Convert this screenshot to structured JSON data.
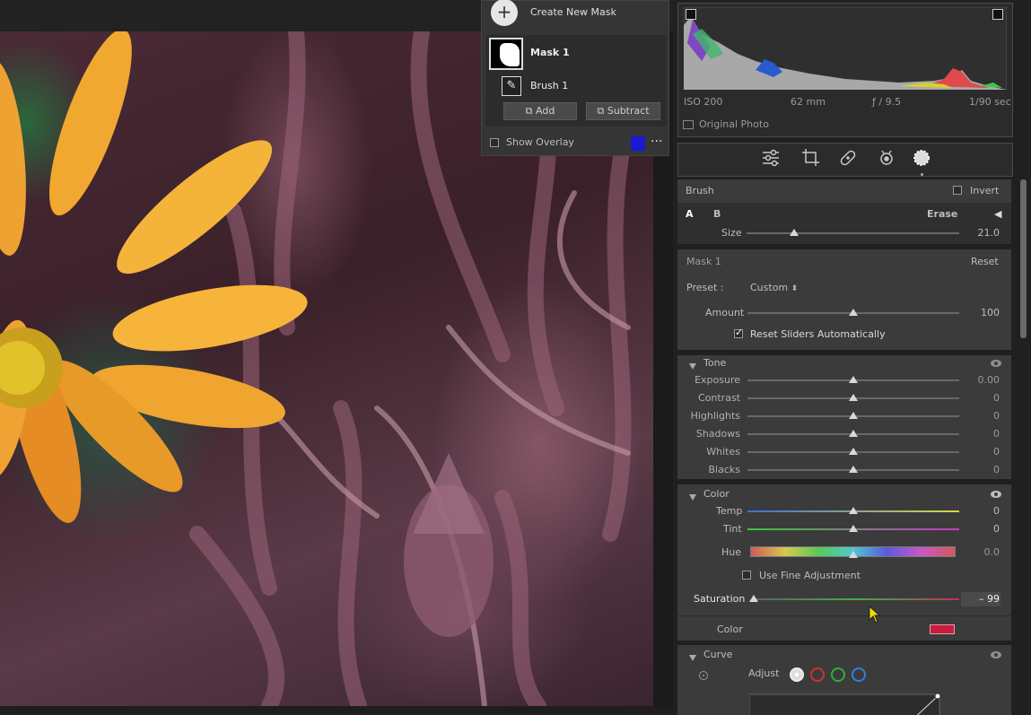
{
  "mask_panel": {
    "create_label": "Create New Mask",
    "mask_name": "Mask 1",
    "brush_name": "Brush 1",
    "add_label": "Add",
    "subtract_label": "Subtract",
    "overlay_label": "Show Overlay",
    "overlay_color": "#1a1ad6",
    "more": "···"
  },
  "histogram": {
    "iso": "ISO 200",
    "focal": "62 mm",
    "aperture": "ƒ / 9.5",
    "shutter": "1/90 sec",
    "original_label": "Original Photo"
  },
  "tools": [
    "sliders-icon",
    "crop-icon",
    "heal-icon",
    "redeye-icon",
    "mask-icon"
  ],
  "brush": {
    "title": "Brush",
    "invert_label": "Invert",
    "a_label": "A",
    "b_label": "B",
    "erase_label": "Erase",
    "size_label": "Size",
    "size_value": "21.0",
    "size_fraction": 0.22
  },
  "mask": {
    "title": "Mask 1",
    "reset_label": "Reset",
    "preset_label": "Preset :",
    "preset_value": "Custom",
    "amount_label": "Amount",
    "amount_value": "100",
    "reset_sliders_label": "Reset Sliders Automatically"
  },
  "tone": {
    "title": "Tone",
    "sliders": [
      {
        "label": "Exposure",
        "value": "0.00"
      },
      {
        "label": "Contrast",
        "value": "0"
      },
      {
        "label": "Highlights",
        "value": "0"
      },
      {
        "label": "Shadows",
        "value": "0"
      },
      {
        "label": "Whites",
        "value": "0"
      },
      {
        "label": "Blacks",
        "value": "0"
      }
    ]
  },
  "color": {
    "title": "Color",
    "temp_label": "Temp",
    "temp_value": "0",
    "tint_label": "Tint",
    "tint_value": "0",
    "hue_label": "Hue",
    "hue_value": "0.0",
    "fine_label": "Use Fine Adjustment",
    "saturation_label": "Saturation",
    "saturation_value": "– 99",
    "color_label": "Color",
    "swatch_color": "#c81e3c"
  },
  "curve": {
    "title": "Curve",
    "adjust_label": "Adjust"
  }
}
